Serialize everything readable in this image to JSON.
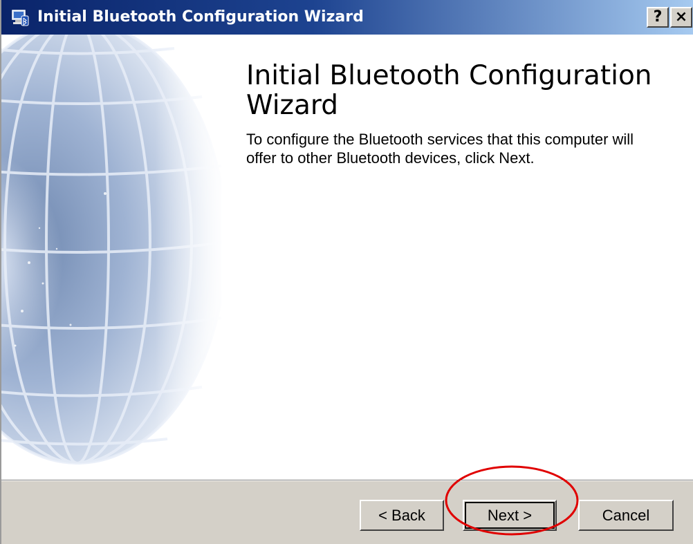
{
  "window": {
    "title": "Initial Bluetooth Configuration Wizard",
    "icon": "bluetooth-computer-icon",
    "help_label": "?",
    "close_label": "×"
  },
  "content": {
    "heading": "Initial Bluetooth Configuration Wizard",
    "description": "To configure the Bluetooth services that this computer will offer to other Bluetooth devices, click Next.",
    "side_image": "globe-wireframe-graphic"
  },
  "buttons": {
    "back": "< Back",
    "next": "Next >",
    "cancel": "Cancel"
  },
  "annotation": {
    "highlight": "red-ellipse-around-next-button",
    "color": "#e00000"
  }
}
